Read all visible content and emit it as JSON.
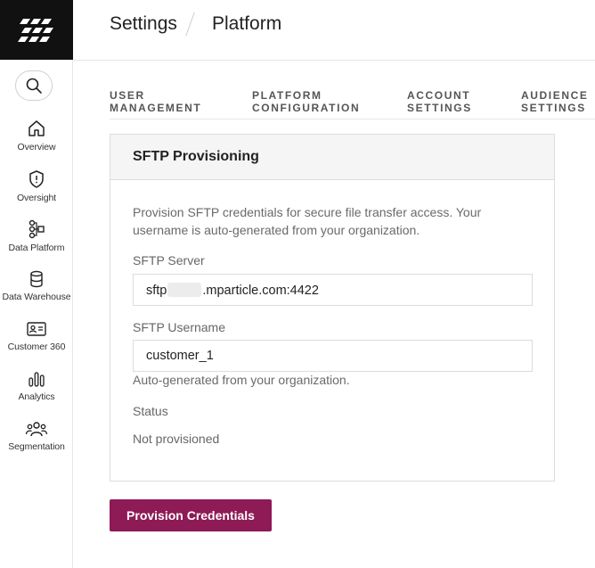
{
  "sidebar": {
    "search_icon": "search-icon",
    "items": [
      {
        "label": "Overview",
        "icon": "home-icon"
      },
      {
        "label": "Oversight",
        "icon": "shield-icon"
      },
      {
        "label": "Data Platform",
        "icon": "data-flow-icon"
      },
      {
        "label": "Data Warehouse",
        "icon": "database-icon"
      },
      {
        "label": "Customer 360",
        "icon": "id-card-icon"
      },
      {
        "label": "Analytics",
        "icon": "bar-chart-icon"
      },
      {
        "label": "Segmentation",
        "icon": "people-icon"
      }
    ]
  },
  "header": {
    "breadcrumb": [
      "Settings",
      "Platform"
    ]
  },
  "tabs": [
    {
      "line1": "USER",
      "line2": "MANAGEMENT"
    },
    {
      "line1": "PLATFORM",
      "line2": "CONFIGURATION"
    },
    {
      "line1": "ACCOUNT",
      "line2": "SETTINGS"
    },
    {
      "line1": "AUDIENCE",
      "line2": "SETTINGS"
    }
  ],
  "card": {
    "title": "SFTP Provisioning",
    "description": "Provision SFTP credentials for secure file transfer access. Your username is auto-generated from your organization.",
    "server_label": "SFTP Server",
    "server_prefix": "sftp",
    "server_suffix": ".mparticle.com:4422",
    "username_label": "SFTP Username",
    "username_value": "customer_1",
    "username_hint": "Auto-generated from your organization.",
    "status_label": "Status",
    "status_value": "Not provisioned"
  },
  "actions": {
    "provision_label": "Provision Credentials"
  },
  "colors": {
    "brand": "#8e1a56",
    "logo_bg": "#111111"
  }
}
